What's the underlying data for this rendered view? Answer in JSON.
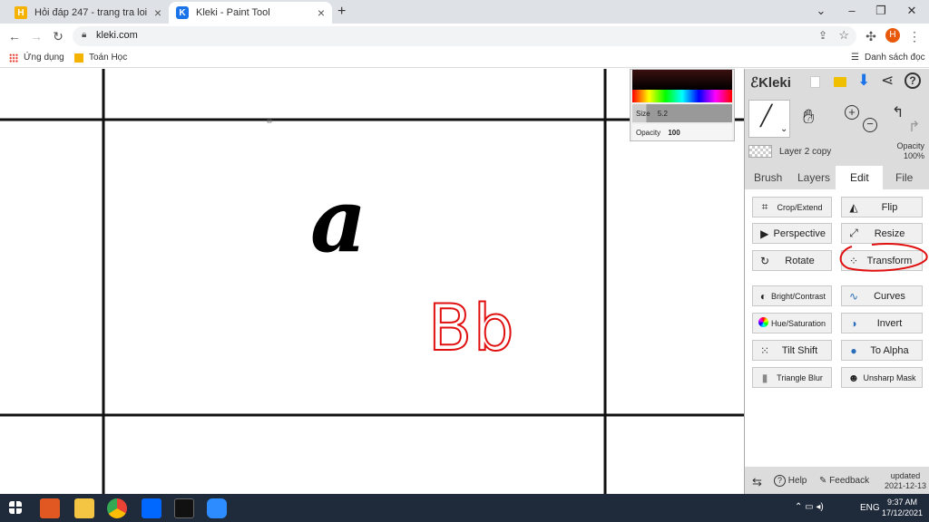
{
  "tabs": [
    {
      "title": "Hỏi đáp 247 - trang tra loi",
      "favicon": "H"
    },
    {
      "title": "Kleki - Paint Tool",
      "favicon": "K"
    }
  ],
  "window_controls": {
    "min": "–",
    "max": "❐",
    "close": "✕",
    "dropdown": "⌄"
  },
  "address": {
    "url": "kleki.com"
  },
  "profile_initial": "H",
  "bookmarks": {
    "apps": "Ứng dụng",
    "item1": "Toán Học",
    "reading_list": "Danh sách đọc"
  },
  "canvas": {
    "letter_black": "a",
    "letter_red": "Bb"
  },
  "color_picker": {
    "size_label": "Size",
    "size_value": "5.2",
    "opacity_label": "Opacity",
    "opacity_value": "100"
  },
  "panel": {
    "logo": "Kleki",
    "layer_name": "Layer 2 copy",
    "layer_opacity_label": "Opacity",
    "layer_opacity_value": "100%",
    "tabs": [
      "Brush",
      "Layers",
      "Edit",
      "File"
    ],
    "buttons": [
      "Crop/Extend",
      "Flip",
      "Perspective",
      "Resize",
      "Rotate",
      "Transform",
      "Bright/Contrast",
      "Curves",
      "Hue/Saturation",
      "Invert",
      "Tilt Shift",
      "To Alpha",
      "Triangle Blur",
      "Unsharp Mask"
    ],
    "footer": {
      "help": "Help",
      "feedback": "Feedback",
      "updated_label": "updated",
      "updated_date": "2021-12-13"
    }
  },
  "taskbar": {
    "time": "9:37 AM",
    "date": "17/12/2021",
    "lang": "ENG"
  }
}
